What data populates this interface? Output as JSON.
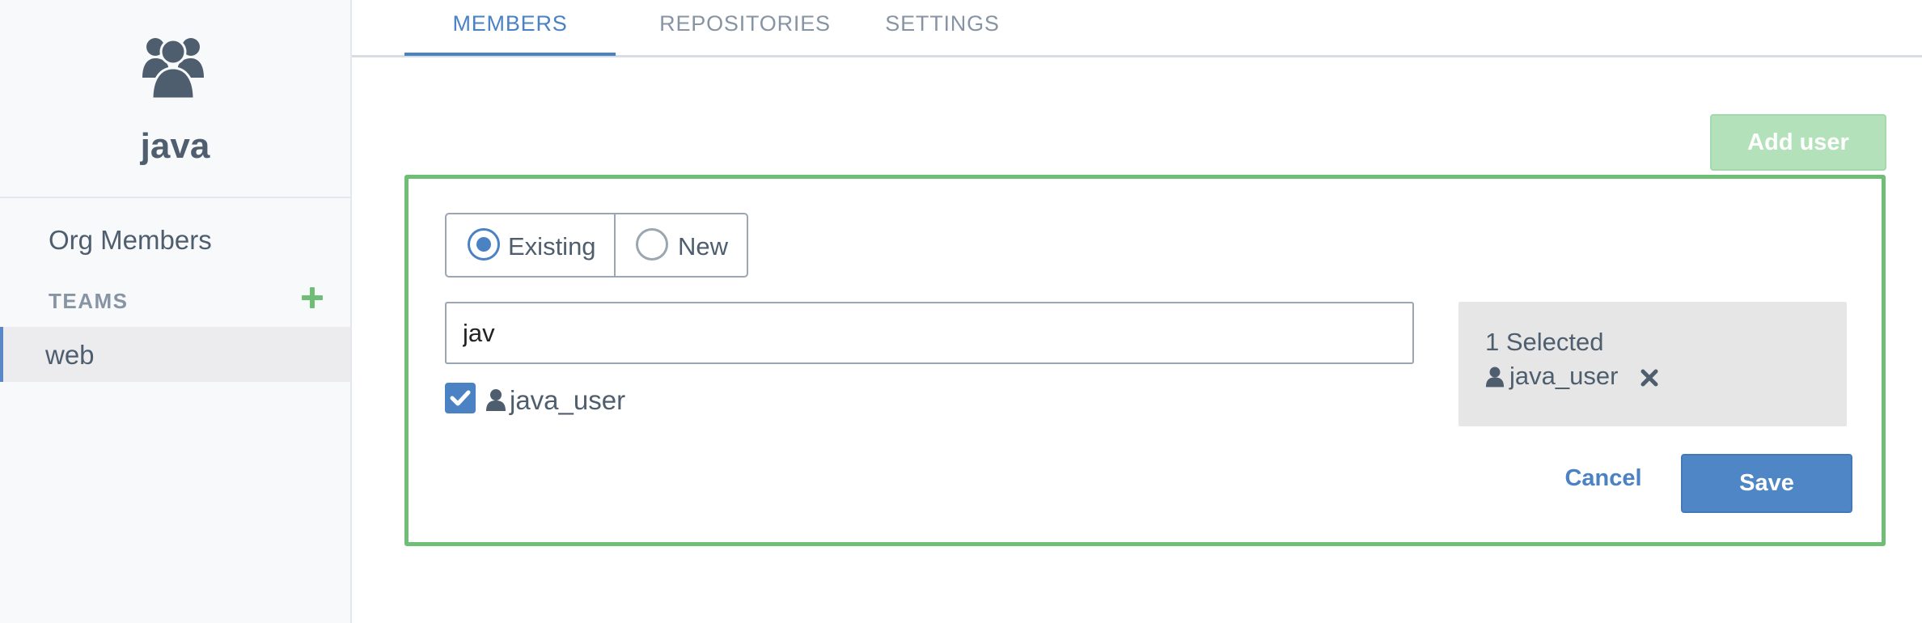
{
  "colors": {
    "accent": "#4a82c3",
    "success_border": "#6ebe75",
    "add_user_disabled": "#b3e2ba",
    "sidebar_bg": "#f8f9fb",
    "text": "#4f5e6e",
    "muted": "#8794a3"
  },
  "sidebar": {
    "org_icon": "users-group-icon",
    "org_name": "java",
    "org_members_label": "Org Members",
    "teams_heading": "TEAMS",
    "add_team_icon": "plus-icon",
    "teams": [
      {
        "label": "web",
        "selected": true
      }
    ]
  },
  "tabs": [
    {
      "label": "MEMBERS",
      "active": true
    },
    {
      "label": "REPOSITORIES",
      "active": false
    },
    {
      "label": "SETTINGS",
      "active": false
    }
  ],
  "toolbar": {
    "add_user_label": "Add user"
  },
  "add_member_panel": {
    "mode_options": [
      {
        "label": "Existing",
        "checked": true
      },
      {
        "label": "New",
        "checked": false
      }
    ],
    "search": {
      "value": "jav",
      "placeholder": ""
    },
    "results": [
      {
        "label": "java_user",
        "checked": true,
        "icon": "user-icon"
      }
    ],
    "selection": {
      "count_label": "1 Selected",
      "items": [
        {
          "label": "java_user",
          "icon": "user-icon",
          "remove_icon": "close-icon"
        }
      ]
    },
    "cancel_label": "Cancel",
    "save_label": "Save"
  }
}
